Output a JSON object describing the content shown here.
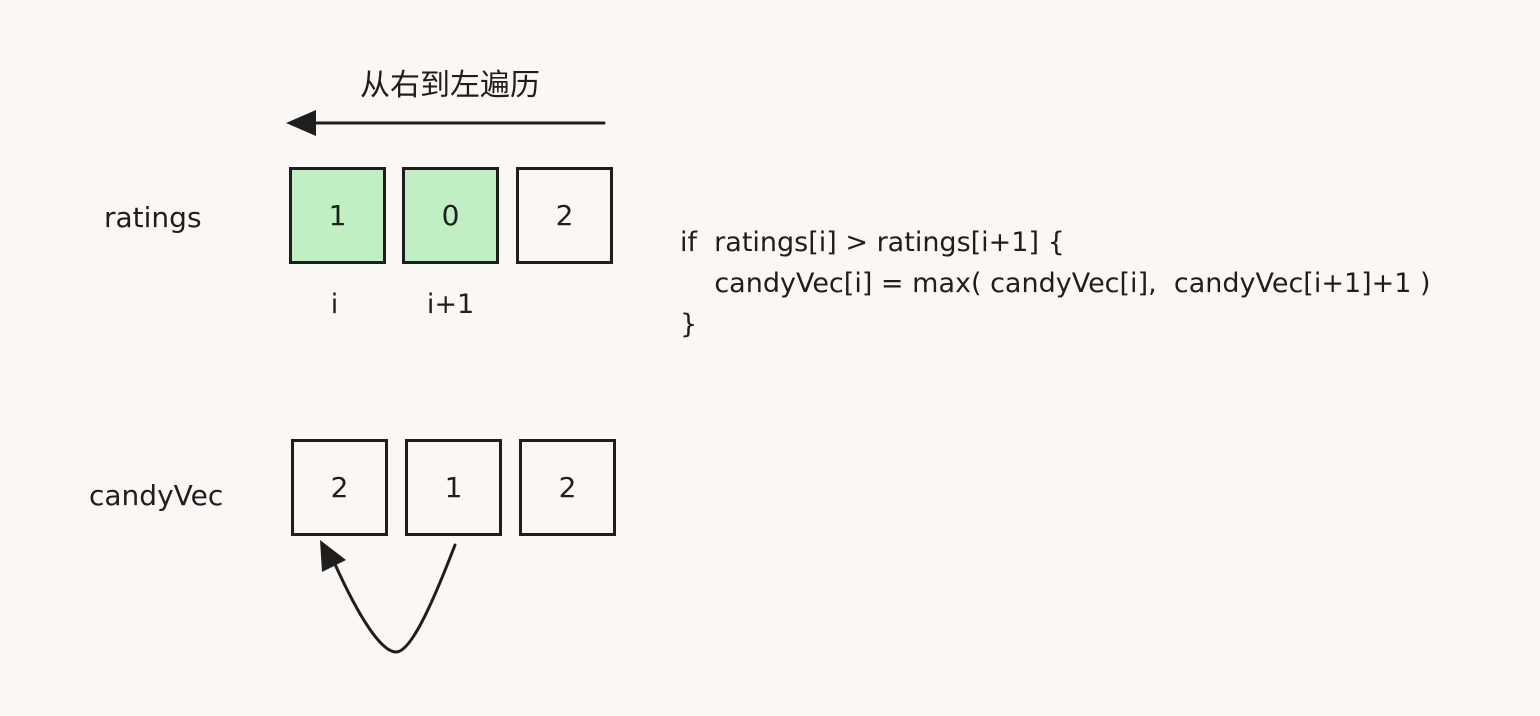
{
  "title": "从右到左遍历",
  "ratings": {
    "label": "ratings",
    "cells": [
      {
        "value": "1",
        "highlighted": true
      },
      {
        "value": "0",
        "highlighted": true
      },
      {
        "value": "2",
        "highlighted": false
      }
    ],
    "index_labels": [
      "i",
      "i+1"
    ]
  },
  "candyVec": {
    "label": "candyVec",
    "cells": [
      {
        "value": "2"
      },
      {
        "value": "1"
      },
      {
        "value": "2"
      }
    ]
  },
  "code": {
    "line1": "if  ratings[i] > ratings[i+1] {",
    "line2": "    candyVec[i] = max( candyVec[i],  candyVec[i+1]+1 )",
    "line3": "}"
  },
  "colors": {
    "highlight": "#c1efc4",
    "stroke": "#1e1e1e",
    "background": "#faf7f4"
  }
}
